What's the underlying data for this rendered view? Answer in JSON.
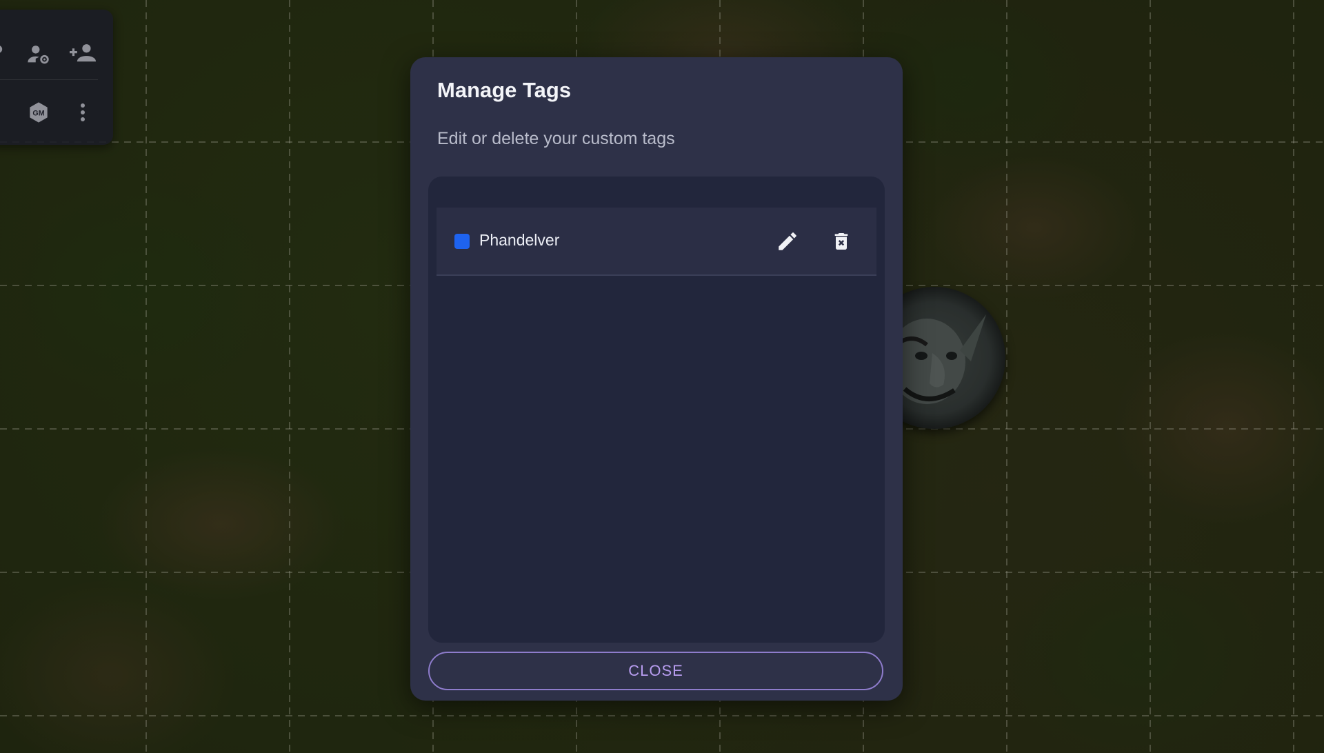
{
  "dialog": {
    "title": "Manage Tags",
    "subtitle": "Edit or delete your custom tags",
    "close_label": "CLOSE"
  },
  "tags": [
    {
      "label": "Phandelver",
      "color": "#1e63f0"
    }
  ],
  "toolbar": {
    "icons": [
      "manage-players-icon",
      "player-settings-icon",
      "add-player-icon",
      "gm-badge-icon",
      "more-vert-icon"
    ]
  },
  "colors": {
    "modal_bg": "#2e3148",
    "list_bg": "#22263c",
    "accent": "#b89df0"
  }
}
